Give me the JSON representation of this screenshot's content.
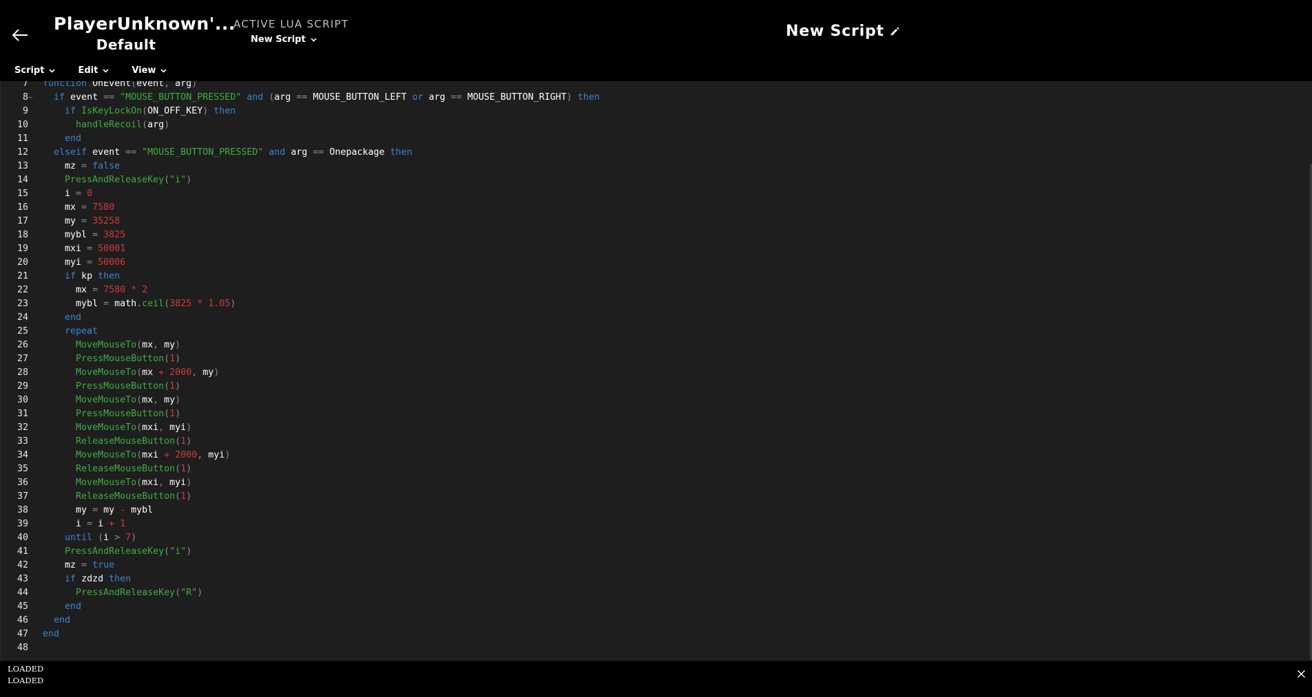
{
  "window": {
    "minimize": "minimize",
    "maximize": "maximize",
    "close": "close"
  },
  "header": {
    "game": "PlayerUnknown'...",
    "profile": "Default",
    "active_label": "ACTIVE LUA SCRIPT",
    "active_script": "New Script",
    "script_title": "New Script"
  },
  "menu": {
    "script": "Script",
    "edit": "Edit",
    "view": "View"
  },
  "editor": {
    "lines": [
      {
        "n": "7",
        "fold": "",
        "t": [
          [
            "k",
            "function "
          ],
          [
            "v",
            "OnEvent"
          ],
          [
            "o",
            "("
          ],
          [
            "v",
            "event"
          ],
          [
            "o",
            ", "
          ],
          [
            "v",
            "arg"
          ],
          [
            "o",
            ")"
          ]
        ]
      },
      {
        "n": "8",
        "fold": "−",
        "t": [
          [
            "c",
            "  "
          ],
          [
            "k",
            "if "
          ],
          [
            "v",
            "event "
          ],
          [
            "o",
            "== "
          ],
          [
            "s",
            "\"MOUSE_BUTTON_PRESSED\" "
          ],
          [
            "k",
            "and "
          ],
          [
            "o",
            "("
          ],
          [
            "v",
            "arg "
          ],
          [
            "o",
            "== "
          ],
          [
            "v",
            "MOUSE_BUTTON_LEFT "
          ],
          [
            "k",
            "or "
          ],
          [
            "v",
            "arg "
          ],
          [
            "o",
            "== "
          ],
          [
            "v",
            "MOUSE_BUTTON_RIGHT"
          ],
          [
            "o",
            ") "
          ],
          [
            "k",
            "then"
          ]
        ]
      },
      {
        "n": "9",
        "fold": "",
        "t": [
          [
            "c",
            "    "
          ],
          [
            "k",
            "if "
          ],
          [
            "f",
            "IsKeyLockOn"
          ],
          [
            "o",
            "("
          ],
          [
            "v",
            "ON_OFF_KEY"
          ],
          [
            "o",
            ") "
          ],
          [
            "k",
            "then"
          ]
        ]
      },
      {
        "n": "10",
        "fold": "",
        "t": [
          [
            "c",
            "      "
          ],
          [
            "f",
            "handleRecoil"
          ],
          [
            "o",
            "("
          ],
          [
            "v",
            "arg"
          ],
          [
            "o",
            ")"
          ]
        ]
      },
      {
        "n": "11",
        "fold": "",
        "t": [
          [
            "c",
            "    "
          ],
          [
            "k",
            "end"
          ]
        ]
      },
      {
        "n": "12",
        "fold": "",
        "t": [
          [
            "c",
            "  "
          ],
          [
            "k",
            "elseif "
          ],
          [
            "v",
            "event "
          ],
          [
            "o",
            "== "
          ],
          [
            "s",
            "\"MOUSE_BUTTON_PRESSED\" "
          ],
          [
            "k",
            "and "
          ],
          [
            "v",
            "arg "
          ],
          [
            "o",
            "== "
          ],
          [
            "v",
            "Onepackage "
          ],
          [
            "k",
            "then"
          ]
        ]
      },
      {
        "n": "13",
        "fold": "",
        "t": [
          [
            "c",
            "    "
          ],
          [
            "v",
            "mz "
          ],
          [
            "o",
            "= "
          ],
          [
            "k",
            "false"
          ]
        ]
      },
      {
        "n": "14",
        "fold": "",
        "t": [
          [
            "c",
            "    "
          ],
          [
            "f",
            "PressAndReleaseKey"
          ],
          [
            "o",
            "("
          ],
          [
            "s",
            "\"i\""
          ],
          [
            "o",
            ")"
          ]
        ]
      },
      {
        "n": "15",
        "fold": "",
        "t": [
          [
            "c",
            "    "
          ],
          [
            "v",
            "i "
          ],
          [
            "o",
            "= "
          ],
          [
            "n",
            "0"
          ]
        ]
      },
      {
        "n": "16",
        "fold": "",
        "t": [
          [
            "c",
            "    "
          ],
          [
            "v",
            "mx "
          ],
          [
            "o",
            "= "
          ],
          [
            "n",
            "7580"
          ]
        ]
      },
      {
        "n": "17",
        "fold": "",
        "t": [
          [
            "c",
            "    "
          ],
          [
            "v",
            "my "
          ],
          [
            "o",
            "= "
          ],
          [
            "n",
            "35258"
          ]
        ]
      },
      {
        "n": "18",
        "fold": "",
        "t": [
          [
            "c",
            "    "
          ],
          [
            "v",
            "mybl "
          ],
          [
            "o",
            "= "
          ],
          [
            "n",
            "3825"
          ]
        ]
      },
      {
        "n": "19",
        "fold": "",
        "t": [
          [
            "c",
            "    "
          ],
          [
            "v",
            "mxi "
          ],
          [
            "o",
            "= "
          ],
          [
            "n",
            "50001"
          ]
        ]
      },
      {
        "n": "20",
        "fold": "",
        "t": [
          [
            "c",
            "    "
          ],
          [
            "v",
            "myi "
          ],
          [
            "o",
            "= "
          ],
          [
            "n",
            "50006"
          ]
        ]
      },
      {
        "n": "21",
        "fold": "",
        "t": [
          [
            "c",
            "    "
          ],
          [
            "k",
            "if "
          ],
          [
            "v",
            "kp "
          ],
          [
            "k",
            "then"
          ]
        ]
      },
      {
        "n": "22",
        "fold": "",
        "t": [
          [
            "c",
            "      "
          ],
          [
            "v",
            "mx "
          ],
          [
            "o",
            "= "
          ],
          [
            "n",
            "7580 "
          ],
          [
            "op-red",
            "* "
          ],
          [
            "n",
            "2"
          ]
        ]
      },
      {
        "n": "23",
        "fold": "",
        "t": [
          [
            "c",
            "      "
          ],
          [
            "v",
            "mybl "
          ],
          [
            "o",
            "= "
          ],
          [
            "v",
            "math"
          ],
          [
            "o",
            "."
          ],
          [
            "f",
            "ceil"
          ],
          [
            "o",
            "("
          ],
          [
            "n",
            "3825 "
          ],
          [
            "op-red",
            "* "
          ],
          [
            "n",
            "1.05"
          ],
          [
            "o",
            ")"
          ]
        ]
      },
      {
        "n": "24",
        "fold": "",
        "t": [
          [
            "c",
            "    "
          ],
          [
            "k",
            "end"
          ]
        ]
      },
      {
        "n": "25",
        "fold": "",
        "t": [
          [
            "c",
            "    "
          ],
          [
            "k",
            "repeat"
          ]
        ]
      },
      {
        "n": "26",
        "fold": "",
        "t": [
          [
            "c",
            "      "
          ],
          [
            "f",
            "MoveMouseTo"
          ],
          [
            "o",
            "("
          ],
          [
            "v",
            "mx"
          ],
          [
            "o",
            ", "
          ],
          [
            "v",
            "my"
          ],
          [
            "o",
            ")"
          ]
        ]
      },
      {
        "n": "27",
        "fold": "",
        "t": [
          [
            "c",
            "      "
          ],
          [
            "f",
            "PressMouseButton"
          ],
          [
            "o",
            "("
          ],
          [
            "n",
            "1"
          ],
          [
            "o",
            ")"
          ]
        ]
      },
      {
        "n": "28",
        "fold": "",
        "t": [
          [
            "c",
            "      "
          ],
          [
            "f",
            "MoveMouseTo"
          ],
          [
            "o",
            "("
          ],
          [
            "v",
            "mx "
          ],
          [
            "op-red",
            "+ "
          ],
          [
            "n",
            "2000"
          ],
          [
            "o",
            ", "
          ],
          [
            "v",
            "my"
          ],
          [
            "o",
            ")"
          ]
        ]
      },
      {
        "n": "29",
        "fold": "",
        "t": [
          [
            "c",
            "      "
          ],
          [
            "f",
            "PressMouseButton"
          ],
          [
            "o",
            "("
          ],
          [
            "n",
            "1"
          ],
          [
            "o",
            ")"
          ]
        ]
      },
      {
        "n": "30",
        "fold": "",
        "t": [
          [
            "c",
            "      "
          ],
          [
            "f",
            "MoveMouseTo"
          ],
          [
            "o",
            "("
          ],
          [
            "v",
            "mx"
          ],
          [
            "o",
            ", "
          ],
          [
            "v",
            "my"
          ],
          [
            "o",
            ")"
          ]
        ]
      },
      {
        "n": "31",
        "fold": "",
        "t": [
          [
            "c",
            "      "
          ],
          [
            "f",
            "PressMouseButton"
          ],
          [
            "o",
            "("
          ],
          [
            "n",
            "1"
          ],
          [
            "o",
            ")"
          ]
        ]
      },
      {
        "n": "32",
        "fold": "",
        "t": [
          [
            "c",
            "      "
          ],
          [
            "f",
            "MoveMouseTo"
          ],
          [
            "o",
            "("
          ],
          [
            "v",
            "mxi"
          ],
          [
            "o",
            ", "
          ],
          [
            "v",
            "myi"
          ],
          [
            "o",
            ")"
          ]
        ]
      },
      {
        "n": "33",
        "fold": "",
        "t": [
          [
            "c",
            "      "
          ],
          [
            "f",
            "ReleaseMouseButton"
          ],
          [
            "o",
            "("
          ],
          [
            "n",
            "1"
          ],
          [
            "o",
            ")"
          ]
        ]
      },
      {
        "n": "34",
        "fold": "",
        "t": [
          [
            "c",
            "      "
          ],
          [
            "f",
            "MoveMouseTo"
          ],
          [
            "o",
            "("
          ],
          [
            "v",
            "mxi "
          ],
          [
            "op-red",
            "+ "
          ],
          [
            "n",
            "2000"
          ],
          [
            "o",
            ", "
          ],
          [
            "v",
            "myi"
          ],
          [
            "o",
            ")"
          ]
        ]
      },
      {
        "n": "35",
        "fold": "",
        "t": [
          [
            "c",
            "      "
          ],
          [
            "f",
            "ReleaseMouseButton"
          ],
          [
            "o",
            "("
          ],
          [
            "n",
            "1"
          ],
          [
            "o",
            ")"
          ]
        ]
      },
      {
        "n": "36",
        "fold": "",
        "t": [
          [
            "c",
            "      "
          ],
          [
            "f",
            "MoveMouseTo"
          ],
          [
            "o",
            "("
          ],
          [
            "v",
            "mxi"
          ],
          [
            "o",
            ", "
          ],
          [
            "v",
            "myi"
          ],
          [
            "o",
            ")"
          ]
        ]
      },
      {
        "n": "37",
        "fold": "",
        "t": [
          [
            "c",
            "      "
          ],
          [
            "f",
            "ReleaseMouseButton"
          ],
          [
            "o",
            "("
          ],
          [
            "n",
            "1"
          ],
          [
            "o",
            ")"
          ]
        ]
      },
      {
        "n": "38",
        "fold": "",
        "t": [
          [
            "c",
            "      "
          ],
          [
            "v",
            "my "
          ],
          [
            "o",
            "= "
          ],
          [
            "v",
            "my "
          ],
          [
            "op-red",
            "- "
          ],
          [
            "v",
            "mybl"
          ]
        ]
      },
      {
        "n": "39",
        "fold": "",
        "t": [
          [
            "c",
            "      "
          ],
          [
            "v",
            "i "
          ],
          [
            "o",
            "= "
          ],
          [
            "v",
            "i "
          ],
          [
            "op-red",
            "+ "
          ],
          [
            "n",
            "1"
          ]
        ]
      },
      {
        "n": "40",
        "fold": "",
        "t": [
          [
            "c",
            "    "
          ],
          [
            "k",
            "until "
          ],
          [
            "o",
            "("
          ],
          [
            "v",
            "i "
          ],
          [
            "o",
            "> "
          ],
          [
            "n",
            "7"
          ],
          [
            "o",
            ")"
          ]
        ]
      },
      {
        "n": "41",
        "fold": "",
        "t": [
          [
            "c",
            "    "
          ],
          [
            "f",
            "PressAndReleaseKey"
          ],
          [
            "o",
            "("
          ],
          [
            "s",
            "\"i\""
          ],
          [
            "o",
            ")"
          ]
        ]
      },
      {
        "n": "42",
        "fold": "",
        "t": [
          [
            "c",
            "    "
          ],
          [
            "v",
            "mz "
          ],
          [
            "o",
            "= "
          ],
          [
            "k",
            "true"
          ]
        ]
      },
      {
        "n": "43",
        "fold": "",
        "t": [
          [
            "c",
            "    "
          ],
          [
            "k",
            "if "
          ],
          [
            "v",
            "zdzd "
          ],
          [
            "k",
            "then"
          ]
        ]
      },
      {
        "n": "44",
        "fold": "",
        "t": [
          [
            "c",
            "      "
          ],
          [
            "f",
            "PressAndReleaseKey"
          ],
          [
            "o",
            "("
          ],
          [
            "s",
            "\"R\""
          ],
          [
            "o",
            ")"
          ]
        ]
      },
      {
        "n": "45",
        "fold": "",
        "t": [
          [
            "c",
            "    "
          ],
          [
            "k",
            "end"
          ]
        ]
      },
      {
        "n": "46",
        "fold": "",
        "t": [
          [
            "c",
            "  "
          ],
          [
            "k",
            "end"
          ]
        ]
      },
      {
        "n": "47",
        "fold": "",
        "t": [
          [
            "k",
            "end"
          ]
        ]
      },
      {
        "n": "48",
        "fold": "",
        "t": []
      }
    ]
  },
  "output": {
    "lines": [
      "LOADED",
      "LOADED"
    ]
  },
  "colors": {
    "keyword": "#3c83cf",
    "string": "#3fae3f",
    "number": "#d23a3a",
    "editor_bg": "#1e1e1e",
    "header_bg": "#000000"
  }
}
